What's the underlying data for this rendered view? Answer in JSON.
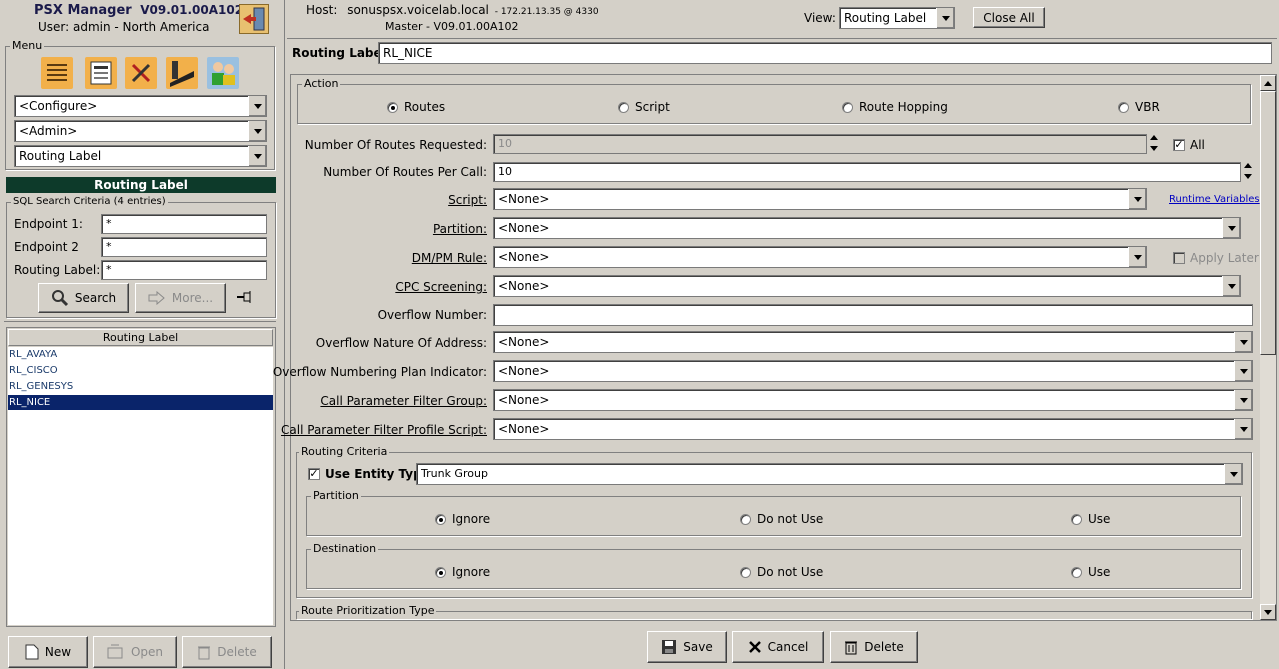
{
  "app": {
    "title": "PSX Manager",
    "version": "V09.01.00A102",
    "user_line": "User:  admin - North America"
  },
  "menu": {
    "label": "Menu",
    "dropdowns": [
      "<Configure>",
      "<Admin>",
      "Routing Label"
    ]
  },
  "sidebar_panel": {
    "title": "Routing Label",
    "criteria_label": "SQL Search Criteria (4 entries)",
    "fields": [
      {
        "label": "Endpoint 1:",
        "value": "*"
      },
      {
        "label": "Endpoint 2",
        "value": "*"
      },
      {
        "label": "Routing Label:",
        "value": "*"
      }
    ],
    "search_label": "Search",
    "more_label": "More...",
    "list_header": "Routing Label",
    "list_items": [
      "RL_AVAYA",
      "RL_CISCO",
      "RL_GENESYS",
      "RL_NICE"
    ],
    "selected_item": "RL_NICE",
    "new_label": "New",
    "open_label": "Open",
    "delete_label": "Delete"
  },
  "header": {
    "host_label": "Host:",
    "host_value": "sonuspsx.voicelab.local",
    "host_ip": "- 172.21.13.35 @ 4330",
    "master": "Master - V09.01.00A102",
    "view_label": "View:",
    "view_value": "Routing Label",
    "close_all": "Close All"
  },
  "form": {
    "routing_label_label": "Routing Label:",
    "routing_label_value": "RL_NICE",
    "action_group": "Action",
    "action_options": [
      "Routes",
      "Script",
      "Route Hopping",
      "VBR"
    ],
    "action_selected": "Routes",
    "num_routes_requested_label": "Number Of Routes Requested:",
    "num_routes_requested_value": "10",
    "all_label": "All",
    "all_checked": true,
    "num_routes_per_call_label": "Number Of Routes Per Call:",
    "num_routes_per_call_value": "10",
    "script_label": "Script:",
    "script_value": "<None>",
    "runtime_variables": "Runtime Variables",
    "partition_label": "Partition:",
    "partition_value": "<None>",
    "dmpm_label": "DM/PM Rule:",
    "dmpm_value": "<None>",
    "apply_later": "Apply Later",
    "cpc_label": "CPC Screening:",
    "cpc_value": "<None>",
    "overflow_number_label": "Overflow Number:",
    "overflow_number_value": "",
    "overflow_noa_label": "Overflow Nature Of Address:",
    "overflow_noa_value": "<None>",
    "overflow_npi_label": "Overflow Numbering Plan Indicator:",
    "overflow_npi_value": "<None>",
    "cpfg_label": "Call Parameter Filter Group:",
    "cpfg_value": "<None>",
    "cpfps_label": "Call Parameter Filter Profile Script:",
    "cpfps_value": "<None>",
    "routing_criteria_group": "Routing Criteria",
    "use_entity_type_label": "Use Entity Type",
    "use_entity_type_checked": true,
    "entity_type_value": "Trunk Group",
    "partition_group": "Partition",
    "partition_options": [
      "Ignore",
      "Do not Use",
      "Use"
    ],
    "partition_selected": "Ignore",
    "destination_group": "Destination",
    "destination_options": [
      "Ignore",
      "Do not Use",
      "Use"
    ],
    "destination_selected": "Ignore",
    "route_prioritization_group": "Route Prioritization Type"
  },
  "footer": {
    "save": "Save",
    "cancel": "Cancel",
    "delete": "Delete"
  }
}
